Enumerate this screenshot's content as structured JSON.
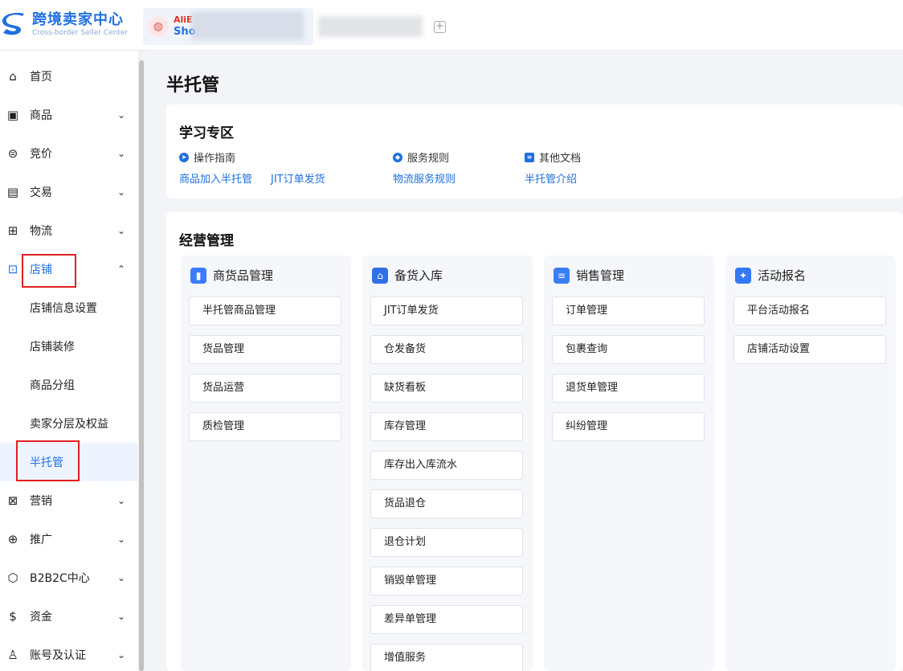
{
  "header": {
    "brand_title": "跨境卖家中心",
    "brand_subtitle": "Cross-border Seller Center",
    "shop_brand": "AliE",
    "shop_name": "Sho",
    "add_tab": "+"
  },
  "sidebar": {
    "items": [
      {
        "label": "首页",
        "icon": "home-icon",
        "glyph": "⌂",
        "chevron": ""
      },
      {
        "label": "商品",
        "icon": "product-icon",
        "glyph": "▣",
        "chevron": "⌄"
      },
      {
        "label": "竞价",
        "icon": "bid-icon",
        "glyph": "⊜",
        "chevron": "⌄"
      },
      {
        "label": "交易",
        "icon": "trade-icon",
        "glyph": "▤",
        "chevron": "⌄"
      },
      {
        "label": "物流",
        "icon": "logistics-icon",
        "glyph": "⊞",
        "chevron": "⌄"
      },
      {
        "label": "店铺",
        "icon": "store-icon",
        "glyph": "⊡",
        "chevron": "⌃"
      }
    ],
    "store_sub": [
      "店铺信息设置",
      "店铺装修",
      "商品分组",
      "卖家分层及权益",
      "半托管"
    ],
    "items_after": [
      {
        "label": "营销",
        "icon": "marketing-icon",
        "glyph": "⊠",
        "chevron": "⌄"
      },
      {
        "label": "推广",
        "icon": "promotion-icon",
        "glyph": "⊕",
        "chevron": "⌄"
      },
      {
        "label": "B2B2C中心",
        "icon": "b2b2c-icon",
        "glyph": "⬡",
        "chevron": "⌄"
      },
      {
        "label": "资金",
        "icon": "funds-icon",
        "glyph": "$",
        "chevron": "⌄"
      },
      {
        "label": "账号及认证",
        "icon": "account-icon",
        "glyph": "♙",
        "chevron": "⌄"
      }
    ]
  },
  "main": {
    "page_title": "半托管",
    "learning": {
      "title": "学习专区",
      "columns": [
        {
          "head": "操作指南",
          "links": [
            "商品加入半托管",
            "JIT订单发货"
          ]
        },
        {
          "head": "服务规则",
          "links": [
            "物流服务规则"
          ]
        },
        {
          "head": "其他文档",
          "links": [
            "半托管介绍"
          ]
        }
      ]
    },
    "operations": {
      "title": "经营管理",
      "groups": [
        {
          "title": "商货品管理",
          "color": "#3b7bff",
          "glyph": "▮",
          "buttons": [
            "半托管商品管理",
            "货品管理",
            "货品运营",
            "质检管理"
          ]
        },
        {
          "title": "备货入库",
          "color": "#2f6fe8",
          "glyph": "⌂",
          "buttons": [
            "JIT订单发货",
            "仓发备货",
            "缺货看板",
            "库存管理",
            "库存出入库流水",
            "货品退仓",
            "退仓计划",
            "销毁单管理",
            "差异单管理",
            "增值服务"
          ]
        },
        {
          "title": "销售管理",
          "color": "#3a7ef5",
          "glyph": "≡",
          "buttons": [
            "订单管理",
            "包裹查询",
            "退货单管理",
            "纠纷管理"
          ]
        },
        {
          "title": "活动报名",
          "color": "#3478f6",
          "glyph": "✦",
          "buttons": [
            "平台活动报名",
            "店铺活动设置"
          ]
        }
      ]
    }
  }
}
